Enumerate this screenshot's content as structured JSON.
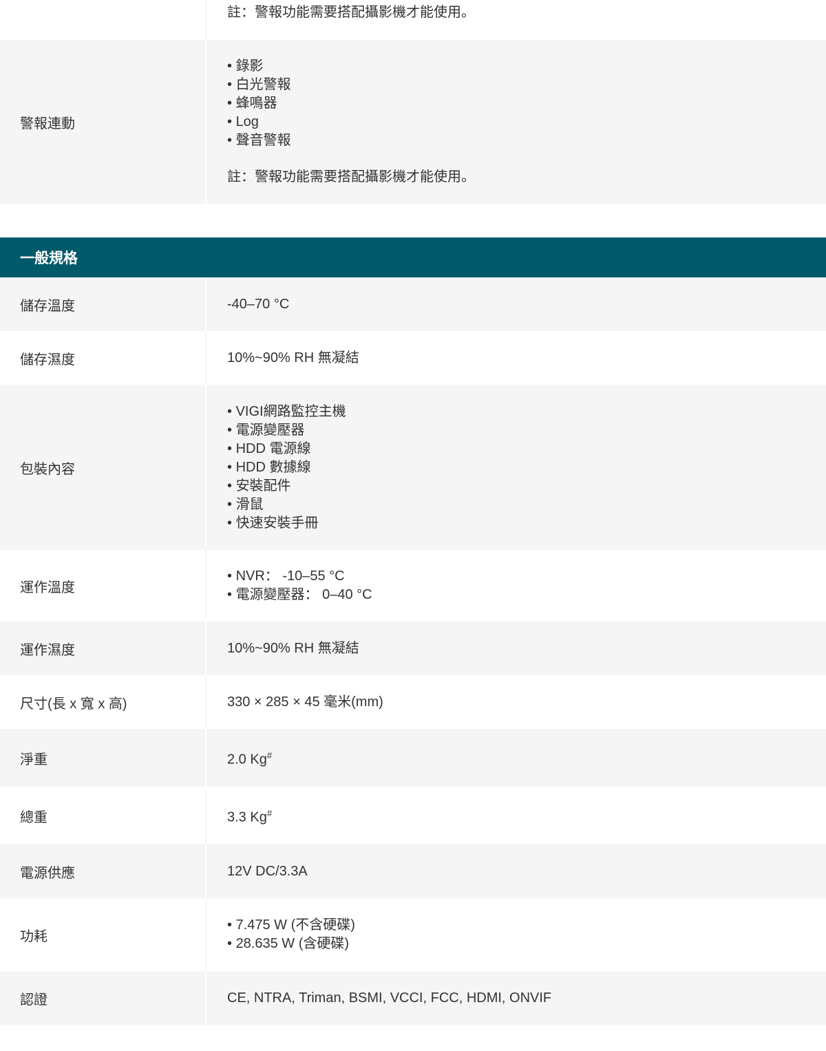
{
  "top_row": {
    "note": "註：警報功能需要搭配攝影機才能使用。"
  },
  "alarm_row": {
    "label": "警報連動",
    "items": [
      "錄影",
      "白光警報",
      "蜂鳴器",
      "Log",
      "聲音警報"
    ],
    "note": "註：警報功能需要搭配攝影機才能使用。"
  },
  "section": {
    "title": "一般規格"
  },
  "specs": {
    "storage_temp": {
      "label": "儲存溫度",
      "value": "-40–70 °C"
    },
    "storage_humidity": {
      "label": "儲存濕度",
      "value": "10%~90% RH 無凝結"
    },
    "package": {
      "label": "包裝內容",
      "items": [
        "VIGI網路監控主機",
        "電源變壓器",
        "HDD 電源線",
        "HDD 數據線",
        "安裝配件",
        "滑鼠",
        "快速安裝手冊"
      ]
    },
    "operating_temp": {
      "label": "運作溫度",
      "items": [
        "NVR： -10–55 °C",
        "電源變壓器： 0–40 °C"
      ]
    },
    "operating_humidity": {
      "label": "運作濕度",
      "value": "10%~90% RH 無凝結"
    },
    "dimensions": {
      "label": "尺寸(長 x 寬 x 高)",
      "value": "330 × 285 × 45 毫米(mm)"
    },
    "net_weight": {
      "label": "淨重",
      "value": "2.0 Kg",
      "sup": "#"
    },
    "gross_weight": {
      "label": "總重",
      "value": "3.3 Kg",
      "sup": "#"
    },
    "power_supply": {
      "label": "電源供應",
      "value": "12V DC/3.3A"
    },
    "power_consumption": {
      "label": "功耗",
      "items": [
        "7.475 W (不含硬碟)",
        "28.635 W (含硬碟)"
      ]
    },
    "certification": {
      "label": "認證",
      "value": "CE, NTRA, Triman, BSMI, VCCI, FCC, HDMI, ONVIF"
    }
  }
}
